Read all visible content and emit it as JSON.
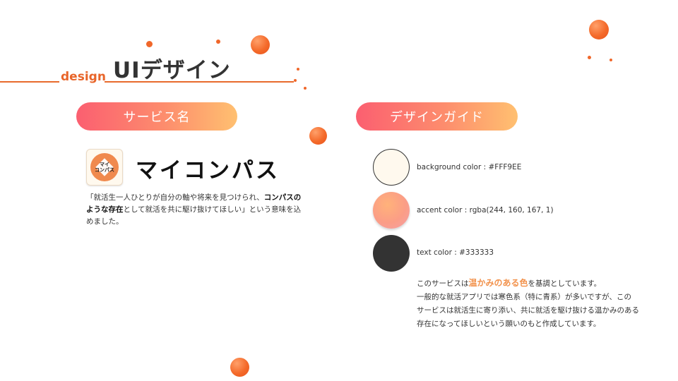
{
  "header": {
    "sub_label": "design",
    "title": "UIデザイン"
  },
  "service_name": {
    "pill_label": "サービス名",
    "logo_text_line1": "マイ",
    "logo_text_line2": "コンパス",
    "wordmark": "マイコンパス",
    "description_part1": "「就活生一人ひとりが自分の軸や将来を見つけられ、",
    "description_bold": "コンパスのような存在",
    "description_part2": "として就活を共に駆け抜けてほしい」という意味を込めました。"
  },
  "design_guide": {
    "pill_label": "デザインガイド",
    "colors": [
      {
        "label": "background color : #FFF9EE",
        "hex": "#FFF9EE"
      },
      {
        "label": "accent color : rgba(244, 160, 167, 1)",
        "hex": "#F4A0A7"
      },
      {
        "label": "text color : #333333",
        "hex": "#333333"
      }
    ],
    "note_pre": "このサービスは",
    "note_highlight": "温かみのある色",
    "note_post": "を基調としています。",
    "note_line2": "一般的な就活アプリでは寒色系（特に青系）が多いですが、この",
    "note_line3": "サービスは就活生に寄り添い、共に就活を駆け抜ける温かみのある",
    "note_line4": "存在になってほしいという願いのもと作成しています。"
  },
  "theme": {
    "accent_orange": "#F0672A",
    "pill_gradient_start": "#FB5F70",
    "pill_gradient_end": "#FFC070"
  }
}
